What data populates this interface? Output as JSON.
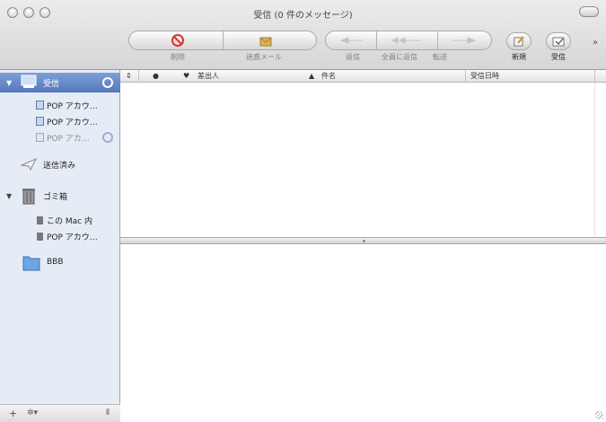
{
  "window": {
    "title": "受信 (0 件のメッセージ)"
  },
  "toolbar": {
    "delete": "削除",
    "junk": "迷惑メール",
    "reply": "返信",
    "reply_all": "全員に返信",
    "forward": "転送",
    "new": "新規",
    "get_mail": "受信",
    "overflow": "»"
  },
  "list": {
    "columns": [
      "",
      "●",
      "♥",
      "差出人",
      "▲",
      "件名",
      "受信日時"
    ]
  },
  "sidebar": {
    "items": [
      {
        "label": "受信",
        "kind": "inbox",
        "selected": true
      },
      {
        "label": "POP アカウ…",
        "kind": "account"
      },
      {
        "label": "POP アカウ…",
        "kind": "account"
      },
      {
        "label": "POP アカ…",
        "kind": "account",
        "dimmed": true
      },
      {
        "label": "送信済み",
        "kind": "sent"
      },
      {
        "label": "ゴミ箱",
        "kind": "trash"
      },
      {
        "label": "この Mac 内",
        "kind": "local"
      },
      {
        "label": "POP アカウ…",
        "kind": "account"
      },
      {
        "label": "BBB",
        "kind": "folder"
      }
    ],
    "bottom": {
      "add": "+",
      "action": "✲▾",
      "resize": "⦀"
    }
  },
  "icons": {
    "delete": "no-entry-icon",
    "junk": "junk-mail-icon",
    "new": "compose-icon",
    "get_mail": "get-mail-icon"
  },
  "colors": {
    "selection": "#5d7fc3",
    "sidebar_bg": "#e6ecf5",
    "delete_red": "#e03030"
  }
}
